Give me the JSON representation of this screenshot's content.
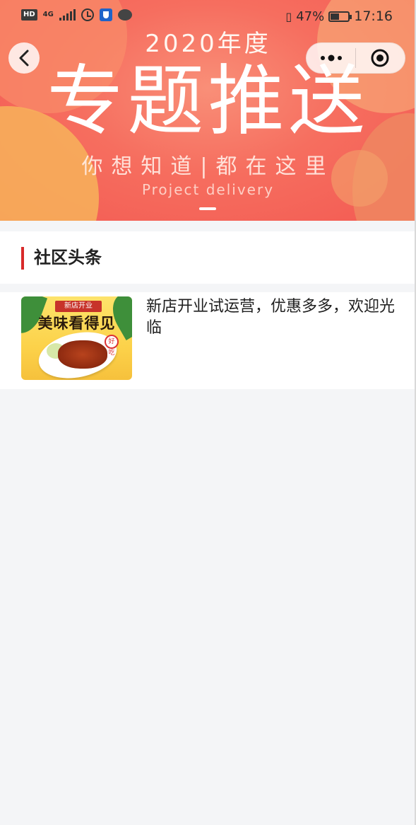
{
  "status_bar": {
    "hd": "HD",
    "network": "4G",
    "battery_pct": "47%",
    "time": "17:16"
  },
  "nav": {
    "back_icon": "back-arrow-icon",
    "more_icon": "more-dots-icon",
    "close_icon": "target-close-icon"
  },
  "banner": {
    "year": "2020年度",
    "title": "专题推送",
    "subtitle": "你想知道|都在这里",
    "english": "Project delivery"
  },
  "section": {
    "title": "社区头条",
    "accent_color": "#d82a2a"
  },
  "news": [
    {
      "thumb_ribbon": "新店开业",
      "thumb_title": "美味看得见",
      "thumb_tag": "好吃",
      "text": "新店开业试运营，优惠多多，欢迎光临"
    }
  ]
}
